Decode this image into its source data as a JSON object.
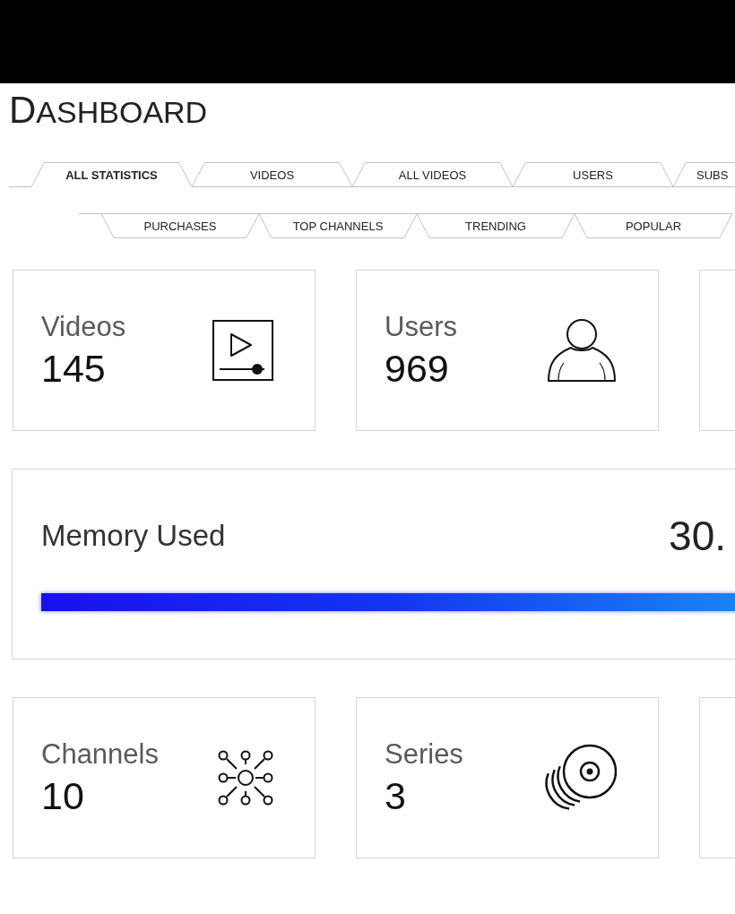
{
  "header": {
    "title": "DASHBOARD"
  },
  "tab_rows": [
    [
      {
        "label": "ALL STATISTICS",
        "selected": true
      },
      {
        "label": "VIDEOS",
        "selected": false
      },
      {
        "label": "ALL VIDEOS",
        "selected": false
      },
      {
        "label": "USERS",
        "selected": false
      },
      {
        "label": "SUBS",
        "selected": false
      }
    ],
    [
      {
        "label": "PURCHASES",
        "selected": false
      },
      {
        "label": "TOP CHANNELS",
        "selected": false
      },
      {
        "label": "TRENDING",
        "selected": false
      },
      {
        "label": "POPULAR",
        "selected": false
      }
    ]
  ],
  "top_cards": [
    {
      "kind": "video",
      "title": "Videos",
      "value": "145"
    },
    {
      "kind": "user",
      "title": "Users",
      "value": "969"
    },
    {
      "kind": "clipped"
    }
  ],
  "memory": {
    "title": "Memory Used",
    "value": "30.",
    "level": 1
  },
  "bottom_cards": [
    {
      "kind": "network",
      "title": "Channels",
      "value": "10"
    },
    {
      "kind": "disc",
      "title": "Series",
      "value": "3"
    },
    {
      "kind": "clipped"
    }
  ]
}
